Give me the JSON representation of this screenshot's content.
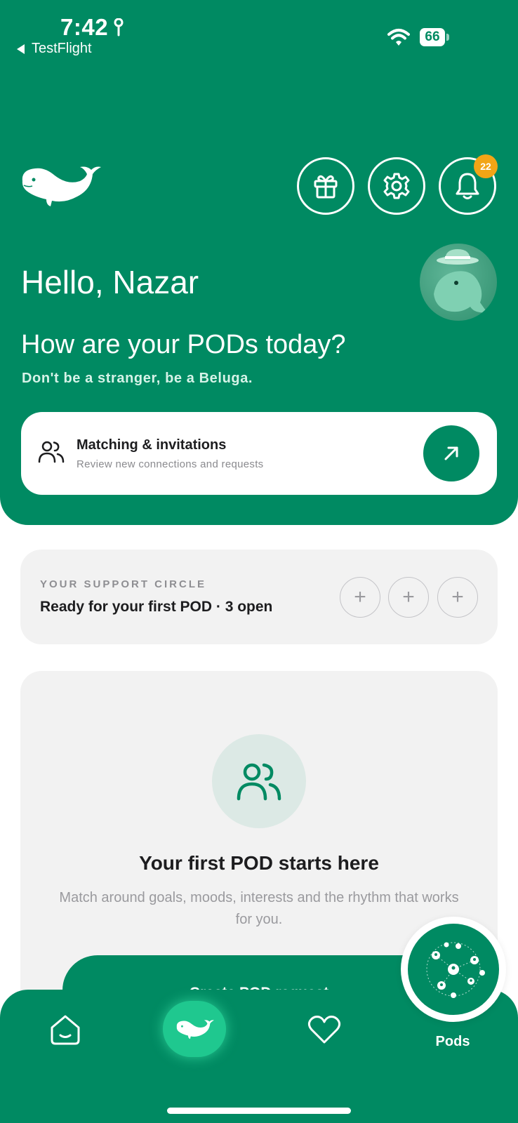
{
  "status_bar": {
    "time": "7:42",
    "back_app": "TestFlight",
    "battery": "66"
  },
  "header": {
    "greeting": "Hello, Nazar",
    "question": "How are your PODs today?",
    "tagline": "Don't be a stranger, be a Beluga.",
    "notification_count": "22",
    "icons": [
      "beluga-logo-icon",
      "gift-icon",
      "gear-icon",
      "bell-icon"
    ]
  },
  "matching_card": {
    "title": "Matching & invitations",
    "subtitle": "Review new connections and requests"
  },
  "support_circle": {
    "label": "YOUR SUPPORT CIRCLE",
    "status": "Ready for your first POD  ·  3 open",
    "slots": [
      "+",
      "+",
      "+"
    ]
  },
  "empty_state": {
    "title": "Your first POD starts here",
    "description": "Match around goals, moods, interests and the rhythm that works for you.",
    "button": "Create POD request"
  },
  "tab_bar": {
    "pods_label": "Pods"
  },
  "colors": {
    "brand_green": "#008a62",
    "badge_orange": "#f2a516",
    "card_gray": "#f2f2f2"
  }
}
